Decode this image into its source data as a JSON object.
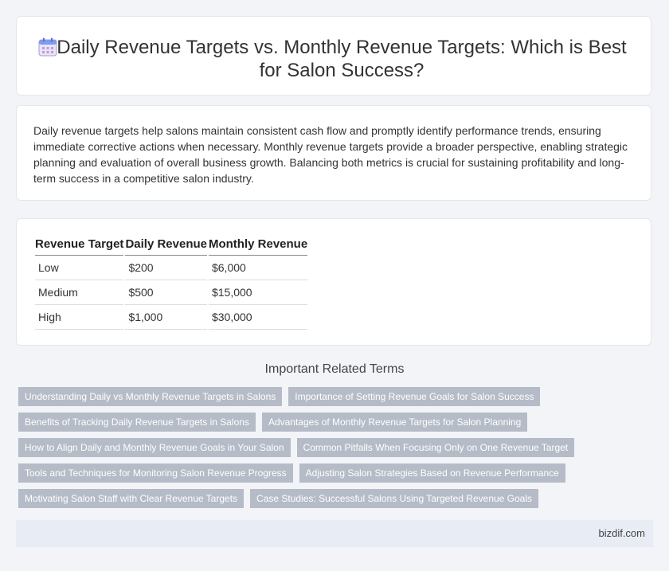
{
  "header": {
    "title": "Daily Revenue Targets vs. Monthly Revenue Targets: Which is Best for Salon Success?",
    "icon": "calendar-icon"
  },
  "summary": {
    "text": "Daily revenue targets help salons maintain consistent cash flow and promptly identify performance trends, ensuring immediate corrective actions when necessary. Monthly revenue targets provide a broader perspective, enabling strategic planning and evaluation of overall business growth. Balancing both metrics is crucial for sustaining profitability and long-term success in a competitive salon industry."
  },
  "table": {
    "headers": [
      "Revenue Target",
      "Daily Revenue",
      "Monthly Revenue"
    ],
    "rows": [
      [
        "Low",
        "$200",
        "$6,000"
      ],
      [
        "Medium",
        "$500",
        "$15,000"
      ],
      [
        "High",
        "$1,000",
        "$30,000"
      ]
    ]
  },
  "related": {
    "heading": "Important Related Terms",
    "tags": [
      "Understanding Daily vs Monthly Revenue Targets in Salons",
      "Importance of Setting Revenue Goals for Salon Success",
      "Benefits of Tracking Daily Revenue Targets in Salons",
      "Advantages of Monthly Revenue Targets for Salon Planning",
      "How to Align Daily and Monthly Revenue Goals in Your Salon",
      "Common Pitfalls When Focusing Only on One Revenue Target",
      "Tools and Techniques for Monitoring Salon Revenue Progress",
      "Adjusting Salon Strategies Based on Revenue Performance",
      "Motivating Salon Staff with Clear Revenue Targets",
      "Case Studies: Successful Salons Using Targeted Revenue Goals"
    ]
  },
  "footer": {
    "site": "bizdif.com"
  }
}
